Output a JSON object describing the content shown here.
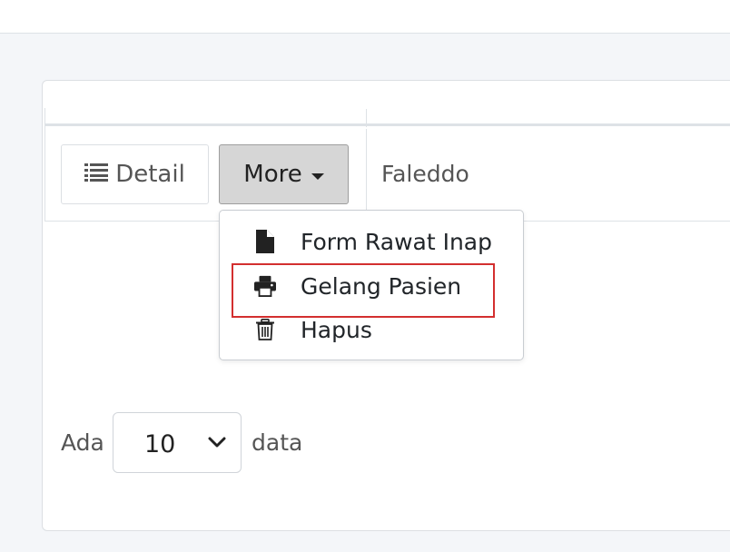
{
  "table": {
    "row": {
      "detail_label": "Detail",
      "more_label": "More",
      "name": "Faleddo"
    }
  },
  "dropdown": {
    "items": [
      {
        "label": "Form Rawat Inap",
        "icon": "file-icon"
      },
      {
        "label": "Gelang Pasien",
        "icon": "print-icon"
      },
      {
        "label": "Hapus",
        "icon": "trash-icon"
      }
    ]
  },
  "footer": {
    "prefix": "Ada",
    "page_size": "10",
    "suffix": "data"
  },
  "colors": {
    "highlight": "#d32f2f",
    "more_button_bg": "#d6d6d6"
  }
}
